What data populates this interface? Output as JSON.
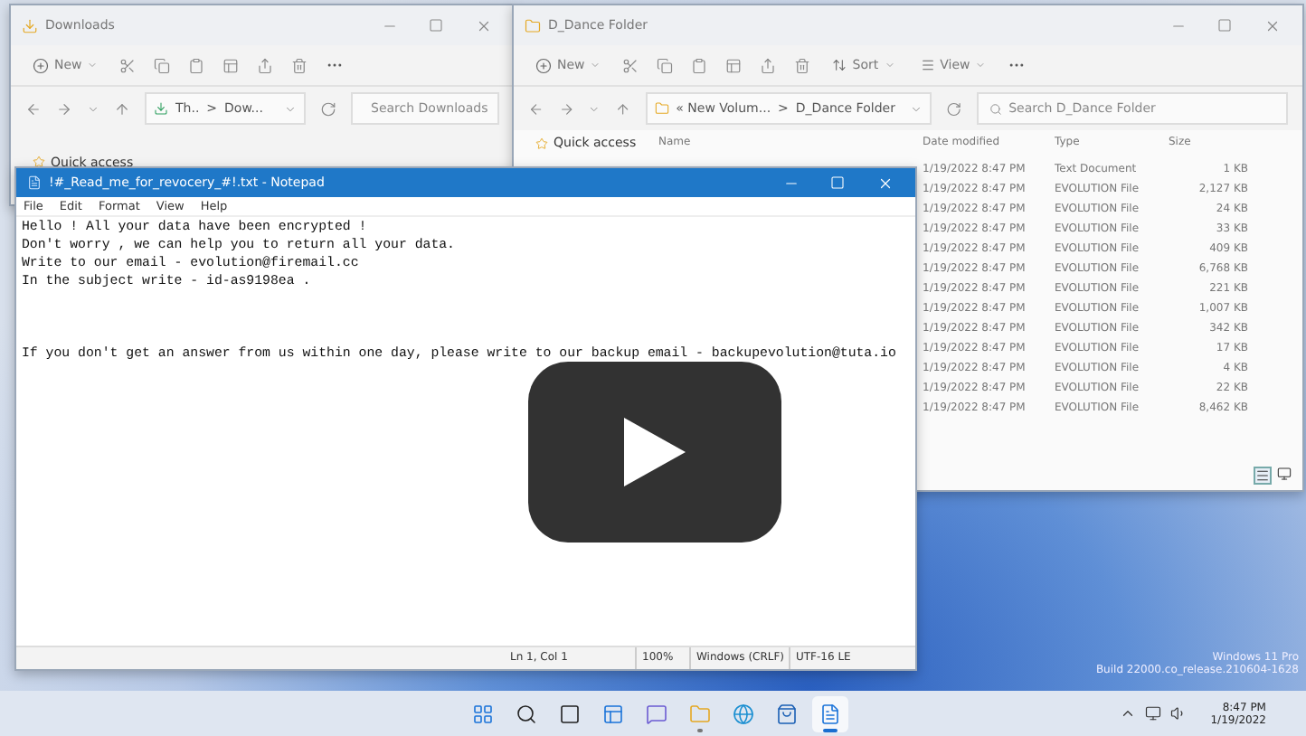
{
  "downloads_window": {
    "title": "Downloads",
    "new_button": "New",
    "breadcrumb": [
      "Th..",
      "Dow..."
    ],
    "breadcrumb_separator": ">",
    "search_placeholder": "Search Downloads",
    "sidebar": [
      "Quick access"
    ]
  },
  "folder_window": {
    "title": "D_Dance Folder",
    "new_button": "New",
    "sort_button": "Sort",
    "view_button": "View",
    "breadcrumb": [
      "« New Volum...",
      "D_Dance Folder"
    ],
    "breadcrumb_separator": ">",
    "search_placeholder": "Search D_Dance Folder",
    "sidebar": [
      "Quick access"
    ],
    "columns": [
      "Name",
      "Date modified",
      "Type",
      "Size"
    ],
    "rows": [
      {
        "date": "1/19/2022 8:47 PM",
        "type": "Text Document",
        "size": "1 KB"
      },
      {
        "date": "1/19/2022 8:47 PM",
        "type": "EVOLUTION File",
        "size": "2,127 KB"
      },
      {
        "date": "1/19/2022 8:47 PM",
        "type": "EVOLUTION File",
        "size": "24 KB"
      },
      {
        "date": "1/19/2022 8:47 PM",
        "type": "EVOLUTION File",
        "size": "33 KB"
      },
      {
        "date": "1/19/2022 8:47 PM",
        "type": "EVOLUTION File",
        "size": "409 KB"
      },
      {
        "date": "1/19/2022 8:47 PM",
        "type": "EVOLUTION File",
        "size": "6,768 KB"
      },
      {
        "date": "1/19/2022 8:47 PM",
        "type": "EVOLUTION File",
        "size": "221 KB"
      },
      {
        "date": "1/19/2022 8:47 PM",
        "type": "EVOLUTION File",
        "size": "1,007 KB"
      },
      {
        "date": "1/19/2022 8:47 PM",
        "type": "EVOLUTION File",
        "size": "342 KB"
      },
      {
        "date": "1/19/2022 8:47 PM",
        "type": "EVOLUTION File",
        "size": "17 KB"
      },
      {
        "date": "1/19/2022 8:47 PM",
        "type": "EVOLUTION File",
        "size": "4 KB"
      },
      {
        "date": "1/19/2022 8:47 PM",
        "type": "EVOLUTION File",
        "size": "22 KB"
      },
      {
        "date": "1/19/2022 8:47 PM",
        "type": "EVOLUTION File",
        "size": "8,462 KB"
      }
    ]
  },
  "notepad": {
    "title": "!#_Read_me_for_revocery_#!.txt - Notepad",
    "menu": [
      "File",
      "Edit",
      "Format",
      "View",
      "Help"
    ],
    "lines": [
      "Hello ! All your data have been encrypted !",
      "Don't worry , we can help you to return all your data.",
      "Write to our email - evolution@firemail.cc",
      "In the subject write - id-as9198ea ."
    ],
    "last_line": "If you don't get an answer from us within one day, please write to our backup email - backupevolution@tuta.io",
    "status": [
      "Ln 1, Col 1",
      "100%",
      "Windows (CRLF)",
      "UTF-16 LE"
    ]
  },
  "os_info": [
    "Windows 11 Pro",
    "Build 22000.co_release.210604-1628"
  ],
  "taskbar": {
    "apps": [
      {
        "kind": "start",
        "open": false,
        "selected": false
      },
      {
        "kind": "search",
        "open": false,
        "selected": false
      },
      {
        "kind": "taskview",
        "open": false,
        "selected": false
      },
      {
        "kind": "widgets",
        "open": false,
        "selected": false
      },
      {
        "kind": "chat",
        "open": false,
        "selected": false
      },
      {
        "kind": "explorer",
        "open": true,
        "selected": false
      },
      {
        "kind": "edge",
        "open": false,
        "selected": false
      },
      {
        "kind": "store",
        "open": false,
        "selected": false
      },
      {
        "kind": "notepad",
        "open": true,
        "selected": true
      }
    ],
    "time": "8:47 PM",
    "date": "1/19/2022"
  }
}
